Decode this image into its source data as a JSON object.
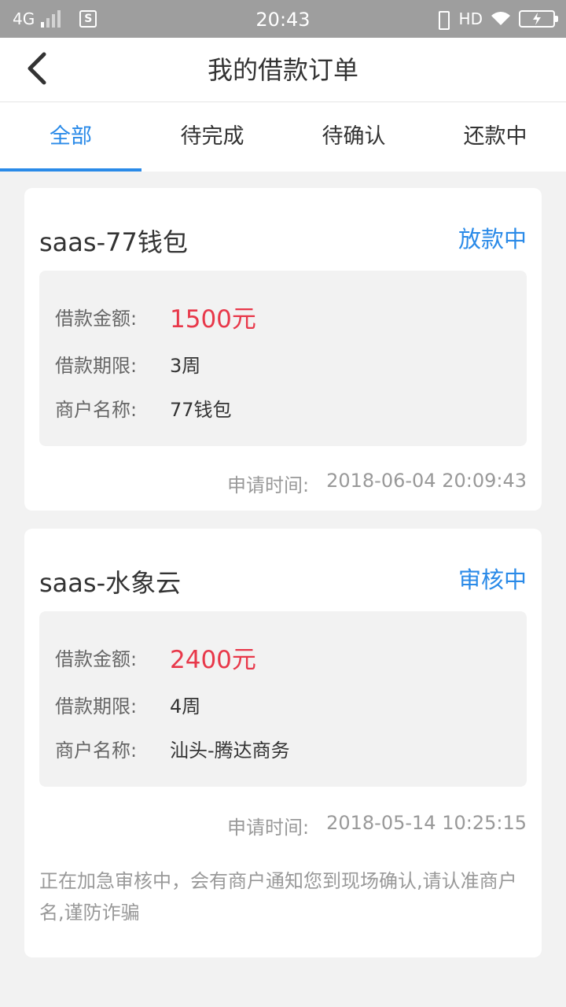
{
  "status_bar": {
    "network": "4G",
    "time": "20:43",
    "hd": "HD"
  },
  "header": {
    "title": "我的借款订单"
  },
  "tabs": [
    {
      "label": "全部",
      "active": true
    },
    {
      "label": "待完成",
      "active": false
    },
    {
      "label": "待确认",
      "active": false
    },
    {
      "label": "还款中",
      "active": false
    }
  ],
  "orders": [
    {
      "title": "saas-77钱包",
      "status": "放款中",
      "amount_label": "借款金额:",
      "amount": "1500元",
      "term_label": "借款期限:",
      "term": "3周",
      "merchant_label": "商户名称:",
      "merchant": "77钱包",
      "apply_time_label": "申请时间:",
      "apply_time": "2018-06-04 20:09:43"
    },
    {
      "title": "saas-水象云",
      "status": "审核中",
      "amount_label": "借款金额:",
      "amount": "2400元",
      "term_label": "借款期限:",
      "term": "4周",
      "merchant_label": "商户名称:",
      "merchant": "汕头-腾达商务",
      "apply_time_label": "申请时间:",
      "apply_time": "2018-05-14 10:25:15",
      "notice": "正在加急审核中，会有商户通知您到现场确认,请认准商户名,谨防诈骗"
    }
  ],
  "colors": {
    "accent": "#2a8ae8",
    "amount": "#e8384a",
    "status_bar": "#9e9e9e",
    "background": "#f2f2f2"
  }
}
